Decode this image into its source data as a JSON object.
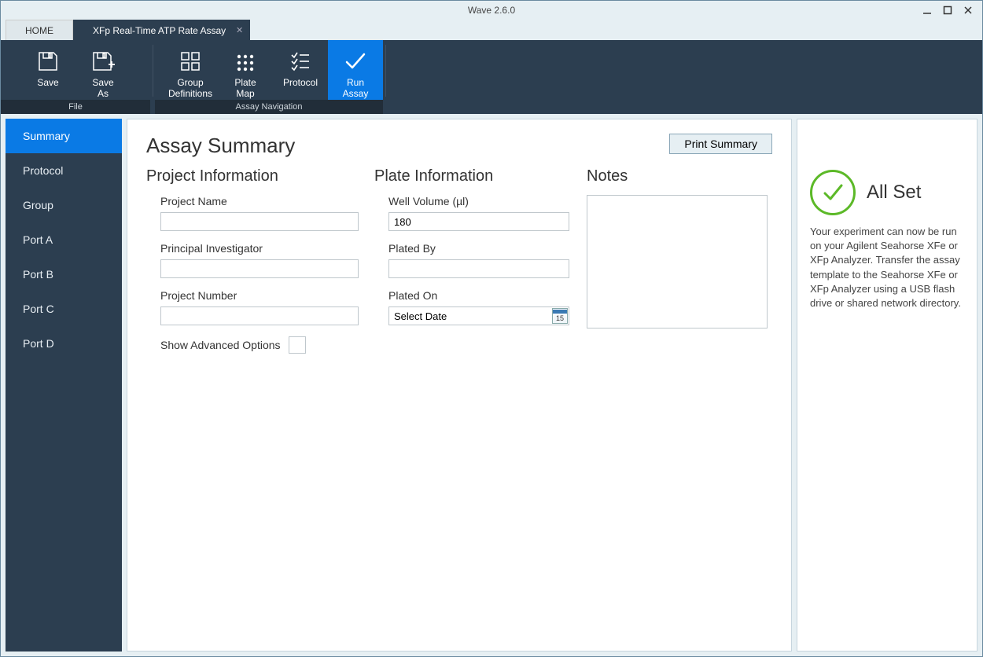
{
  "window": {
    "title": "Wave 2.6.0"
  },
  "tabs": {
    "home": "HOME",
    "active": "XFp Real-Time ATP Rate Assay"
  },
  "ribbon": {
    "file": {
      "group_label": "File",
      "save": "Save",
      "save_as_line1": "Save",
      "save_as_line2": "As"
    },
    "nav": {
      "group_label": "Assay Navigation",
      "group_defs_line1": "Group",
      "group_defs_line2": "Definitions",
      "plate_map_line1": "Plate",
      "plate_map_line2": "Map",
      "protocol": "Protocol",
      "run_assay_line1": "Run",
      "run_assay_line2": "Assay"
    }
  },
  "sidebar": {
    "items": [
      {
        "label": "Summary",
        "active": true
      },
      {
        "label": "Protocol"
      },
      {
        "label": "Group"
      },
      {
        "label": "Port A"
      },
      {
        "label": "Port B"
      },
      {
        "label": "Port C"
      },
      {
        "label": "Port D"
      }
    ]
  },
  "main": {
    "title": "Assay Summary",
    "print_button": "Print Summary",
    "project": {
      "section_title": "Project Information",
      "name_label": "Project Name",
      "name_value": "",
      "pi_label": "Principal Investigator",
      "pi_value": "",
      "number_label": "Project Number",
      "number_value": "",
      "advanced_label": "Show Advanced Options"
    },
    "plate": {
      "section_title": "Plate Information",
      "well_volume_label": "Well Volume (µl)",
      "well_volume_value": "180",
      "plated_by_label": "Plated By",
      "plated_by_value": "",
      "plated_on_label": "Plated On",
      "plated_on_placeholder": "Select Date",
      "cal_day": "15"
    },
    "notes": {
      "section_title": "Notes",
      "value": ""
    }
  },
  "info": {
    "title": "All Set",
    "body": "Your experiment can now be run on your Agilent Seahorse XFe or XFp Analyzer. Transfer the assay template to the Seahorse XFe or XFp Analyzer using a USB flash drive or shared network directory."
  }
}
